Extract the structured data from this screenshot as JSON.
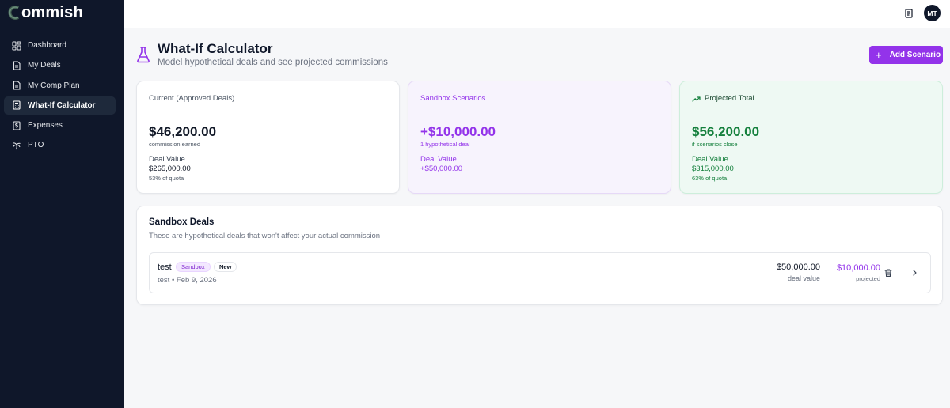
{
  "app": {
    "name": "ommish"
  },
  "sidebar": {
    "items": [
      {
        "label": "Dashboard",
        "icon": "dashboard-icon"
      },
      {
        "label": "My Deals",
        "icon": "document-icon"
      },
      {
        "label": "My Comp Plan",
        "icon": "document-icon"
      },
      {
        "label": "What-If Calculator",
        "icon": "calculator-icon",
        "active": true
      },
      {
        "label": "Expenses",
        "icon": "dollar-document-icon"
      },
      {
        "label": "PTO",
        "icon": "palm-tree-icon"
      }
    ]
  },
  "header": {
    "avatar_initials": "MT"
  },
  "page": {
    "title": "What-If Calculator",
    "subtitle": "Model hypothetical deals and see projected commissions",
    "add_button": "Add Scenario"
  },
  "cards": {
    "current": {
      "label": "Current (Approved Deals)",
      "amount": "$46,200.00",
      "amount_caption": "commission earned",
      "deal_value_label": "Deal Value",
      "deal_value": "$265,000.00",
      "quota": "53% of quota"
    },
    "sandbox": {
      "label": "Sandbox Scenarios",
      "amount": "+$10,000.00",
      "amount_caption": "1 hypothetical deal",
      "deal_value_label": "Deal Value",
      "deal_value": "+$50,000.00"
    },
    "projected": {
      "label": "Projected Total",
      "amount": "$56,200.00",
      "amount_caption": "if scenarios close",
      "deal_value_label": "Deal Value",
      "deal_value": "$315,000.00",
      "quota": "63% of quota"
    }
  },
  "sandbox_deals": {
    "title": "Sandbox Deals",
    "subtitle": "These are hypothetical deals that won't affect your actual commission",
    "rows": [
      {
        "name": "test",
        "badges": [
          "Sandbox",
          "New"
        ],
        "meta": "test • Feb 9, 2026",
        "deal_value": "$50,000.00",
        "deal_value_label": "deal value",
        "projected": "$10,000.00",
        "projected_label": "projected"
      }
    ]
  },
  "colors": {
    "sidebar_bg": "#0f172a",
    "accent_purple": "#9333ea",
    "accent_green": "#15803d"
  }
}
